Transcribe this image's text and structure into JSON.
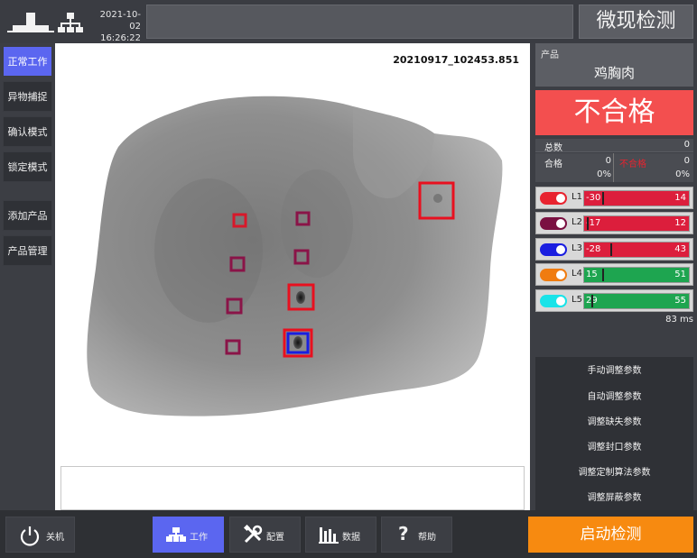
{
  "header": {
    "date": "2021-10-02",
    "time": "16:26:22",
    "title": "微现检测",
    "icons": [
      "machine-icon",
      "network-icon"
    ]
  },
  "nav": {
    "items": [
      {
        "label": "正常工作",
        "active": true
      },
      {
        "label": "异物捕捉",
        "active": false
      },
      {
        "label": "确认模式",
        "active": false
      },
      {
        "label": "锁定模式",
        "active": false
      },
      {
        "label": "添加产品",
        "active": false
      },
      {
        "label": "产品管理",
        "active": false
      }
    ]
  },
  "image": {
    "filename": "20210917_102453.851"
  },
  "product": {
    "label": "产品",
    "name": "鸡胸肉"
  },
  "result": {
    "text": "不合格",
    "color": "#f34f4f"
  },
  "stats": {
    "total_label": "总数",
    "total_value": "0",
    "pass_label": "合格",
    "pass_value": "0",
    "pass_pct": "0%",
    "fail_label": "不合格",
    "fail_value": "0",
    "fail_pct": "0%"
  },
  "channels": [
    {
      "label": "L1",
      "min": "-30",
      "max": "14",
      "color": "#dc1e3c",
      "toggle_color": "#e8232f",
      "marker": 0.17
    },
    {
      "label": "L2",
      "min": "-17",
      "max": "12",
      "color": "#dc1e3c",
      "toggle_color": "#7a1041",
      "marker": 0.03
    },
    {
      "label": "L3",
      "min": "-28",
      "max": "43",
      "color": "#dc1e3c",
      "toggle_color": "#1a1ee0",
      "marker": 0.25
    },
    {
      "label": "L4",
      "min": "15",
      "max": "51",
      "color": "#1ea550",
      "toggle_color": "#f07c10",
      "marker": 0.17
    },
    {
      "label": "L5",
      "min": "29",
      "max": "55",
      "color": "#1ea550",
      "toggle_color": "#19e3e8",
      "marker": 0.07
    }
  ],
  "latency": "83 ms",
  "adjust_menu": [
    "手动调整参数",
    "自动调整参数",
    "调整缺失参数",
    "调整封口参数",
    "调整定制算法参数",
    "调整屏蔽参数"
  ],
  "bottom": {
    "power_label": "关机",
    "work_label": "工作",
    "config_label": "配置",
    "data_label": "数据",
    "help_label": "帮助",
    "start_label": "启动检测"
  }
}
